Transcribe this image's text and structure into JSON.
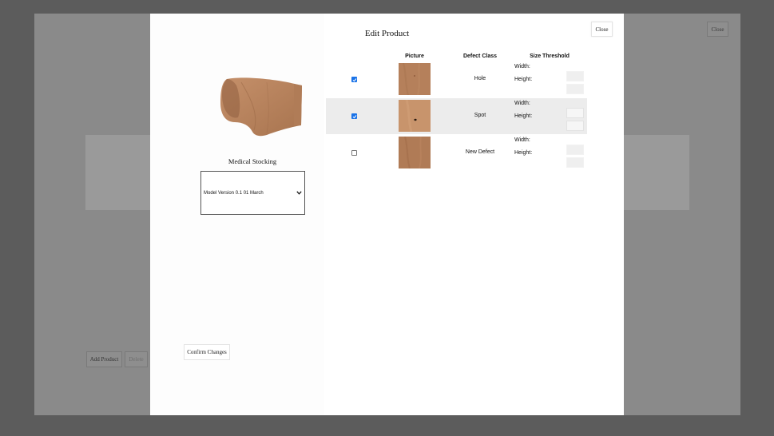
{
  "background": {
    "close_label": "Close",
    "add_product_label": "Add Product",
    "delete_label": "Delete"
  },
  "modal": {
    "title": "Edit Product",
    "close_label": "Close",
    "product_name": "Medical Stocking",
    "model_select": {
      "selected": "Model Version 0.1 01 March"
    },
    "confirm_label": "Confirm Changes"
  },
  "table": {
    "headers": {
      "picture": "Picture",
      "defect_class": "Defect Class",
      "size_threshold": "Size Threshold"
    },
    "rows": [
      {
        "checked": true,
        "defect_class": "Hole",
        "width_label": "Width:",
        "height_label": "Height:"
      },
      {
        "checked": true,
        "defect_class": "Spot",
        "width_label": "Width:",
        "height_label": "Height:"
      },
      {
        "checked": false,
        "defect_class": "New Defect",
        "width_label": "Width:",
        "height_label": "Height:"
      }
    ]
  },
  "colors": {
    "overlay": "#5c5c5c",
    "accent": "#1a73e8",
    "skin": "#b88560"
  }
}
